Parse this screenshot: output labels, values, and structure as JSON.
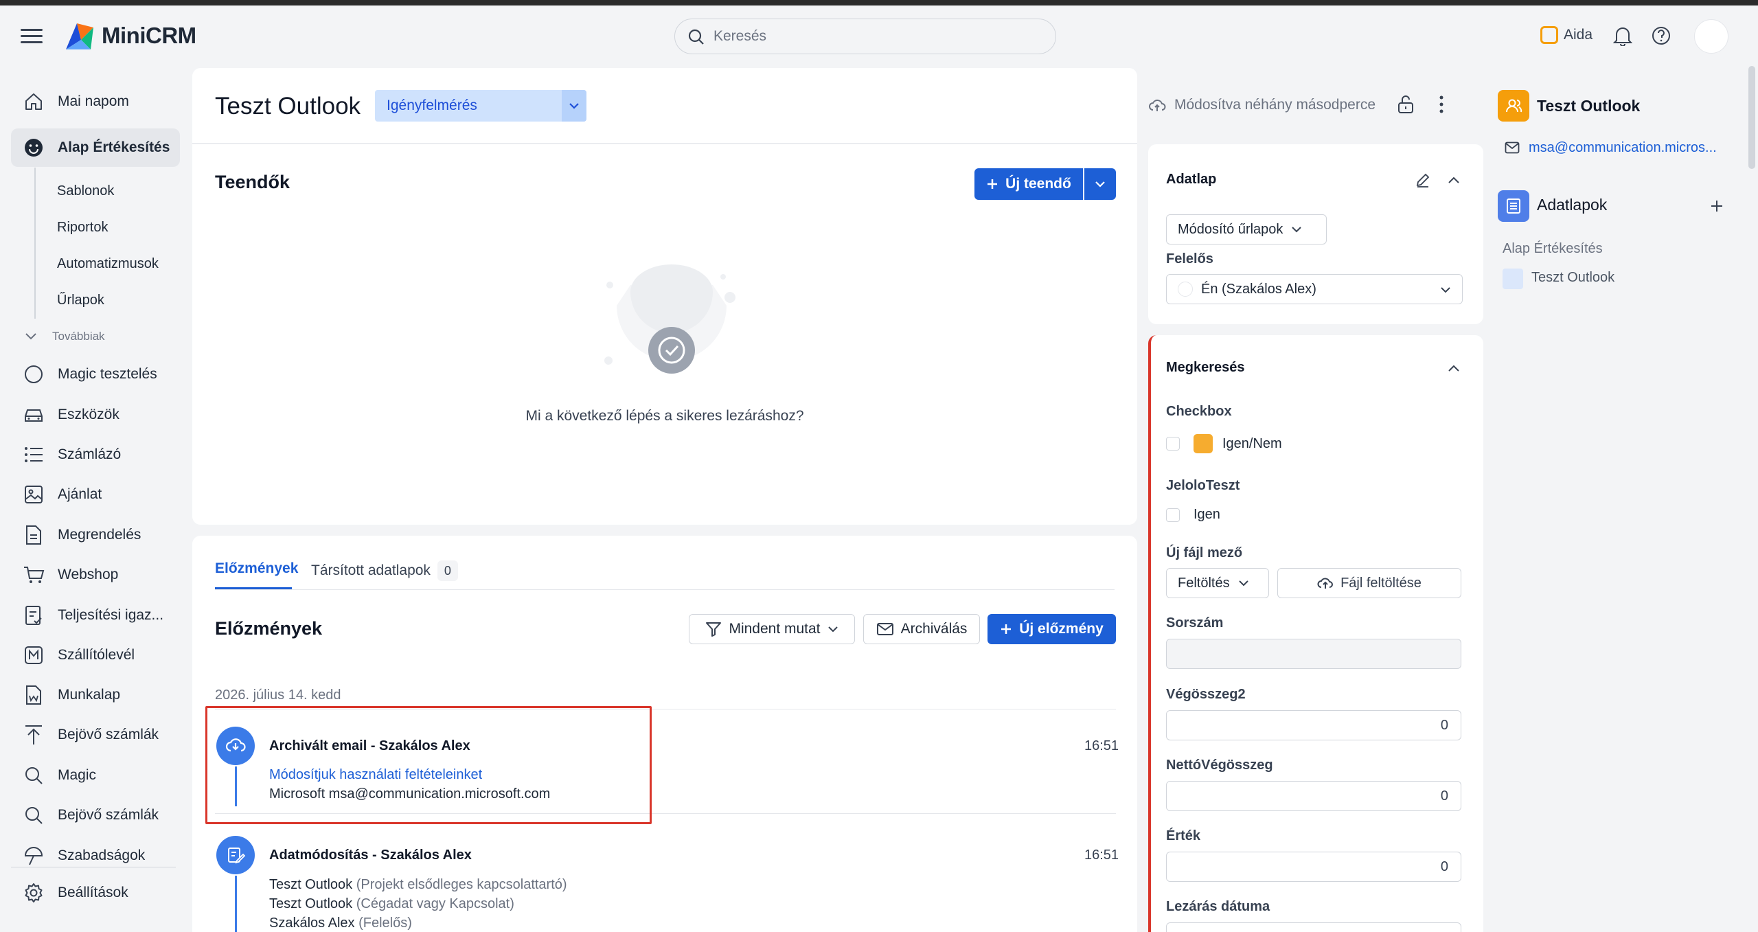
{
  "app": {
    "name": "MiniCRM"
  },
  "search": {
    "placeholder": "Keresés"
  },
  "topbar": {
    "assistant_label": "Aida"
  },
  "sidebar": {
    "items": [
      {
        "label": "Mai napom",
        "icon": "home-icon"
      },
      {
        "label": "Alap Értékesítés",
        "icon": "smile-icon",
        "active": true
      },
      {
        "label": "Magic tesztelés",
        "icon": "circle-icon"
      },
      {
        "label": "Eszközök",
        "icon": "car-icon"
      },
      {
        "label": "Számlázó",
        "icon": "list-icon"
      },
      {
        "label": "Ajánlat",
        "icon": "image-icon"
      },
      {
        "label": "Megrendelés",
        "icon": "document-icon"
      },
      {
        "label": "Webshop",
        "icon": "cart-icon"
      },
      {
        "label": "Teljesítési igaz...",
        "icon": "checklist-icon"
      },
      {
        "label": "Szállítólevél",
        "icon": "letter-m-icon"
      },
      {
        "label": "Munkalap",
        "icon": "worksheet-icon"
      },
      {
        "label": "Bejövő számlák",
        "icon": "upload-icon"
      },
      {
        "label": "Magic",
        "icon": "search-icon"
      },
      {
        "label": "Bejövő számlák",
        "icon": "search-icon"
      },
      {
        "label": "Szabadságok",
        "icon": "umbrella-icon"
      }
    ],
    "sub_items": [
      "Sablonok",
      "Riportok",
      "Automatizmusok",
      "Űrlapok"
    ],
    "more_label": "Továbbiak",
    "settings_label": "Beállítások"
  },
  "header": {
    "title": "Teszt Outlook",
    "stage": "Igényfelmérés",
    "modified": "Módosítva néhány másodperce"
  },
  "tasks": {
    "title": "Teendők",
    "new_button": "Új teendő",
    "empty_text": "Mi a következő lépés a sikeres lezáráshoz?"
  },
  "history": {
    "tabs": [
      {
        "label": "Előzmények"
      },
      {
        "label": "Társított adatlapok",
        "count": "0"
      }
    ],
    "title": "Előzmények",
    "filter_button": "Mindent mutat",
    "archive_button": "Archiválás",
    "new_button": "Új előzmény",
    "date": "2026. július 14. kedd",
    "entries": [
      {
        "title": "Archivált email - Szakálos Alex",
        "time": "16:51",
        "subject": "Módosítjuk használati feltételeinket",
        "from": "Microsoft msa@communication.microsoft.com"
      },
      {
        "title": "Adatmódosítás - Szakálos Alex",
        "time": "16:51",
        "lines": [
          {
            "value": "Teszt Outlook",
            "note": "(Projekt elsődleges kapcsolattartó)"
          },
          {
            "value": "Teszt Outlook",
            "note": "(Cégadat vagy Kapcsolat)"
          },
          {
            "value": "Szakálos Alex",
            "note": "(Felelős)"
          }
        ]
      }
    ]
  },
  "datasheet": {
    "title": "Adatlap",
    "form_select": "Módosító űrlapok",
    "owner_label": "Felelős",
    "owner_value": "Én (Szakálos Alex)"
  },
  "inquiry": {
    "title": "Megkeresés",
    "checkbox_label": "Checkbox",
    "checkbox_option": "Igen/Nem",
    "jelolo_label": "JeloloTeszt",
    "jelolo_option": "Igen",
    "file_label": "Új fájl mező",
    "file_select": "Feltöltés",
    "file_upload": "Fájl feltöltése",
    "serial_label": "Sorszám",
    "total2_label": "Végösszeg2",
    "total2_value": "0",
    "net_label": "NettóVégösszeg",
    "net_value": "0",
    "value_label": "Érték",
    "value_value": "0",
    "close_date_label": "Lezárás dátuma"
  },
  "right_panel": {
    "contact_name": "Teszt Outlook",
    "contact_email": "msa@communication.micros...",
    "sheets_title": "Adatlapok",
    "module": "Alap Értékesítés",
    "sheet_item": "Teszt Outlook"
  },
  "colors": {
    "accent": "#1d5fd6",
    "highlight": "#d9362b",
    "contact_icon": "#f59e0b",
    "sheets_icon": "#4f7ee8"
  }
}
